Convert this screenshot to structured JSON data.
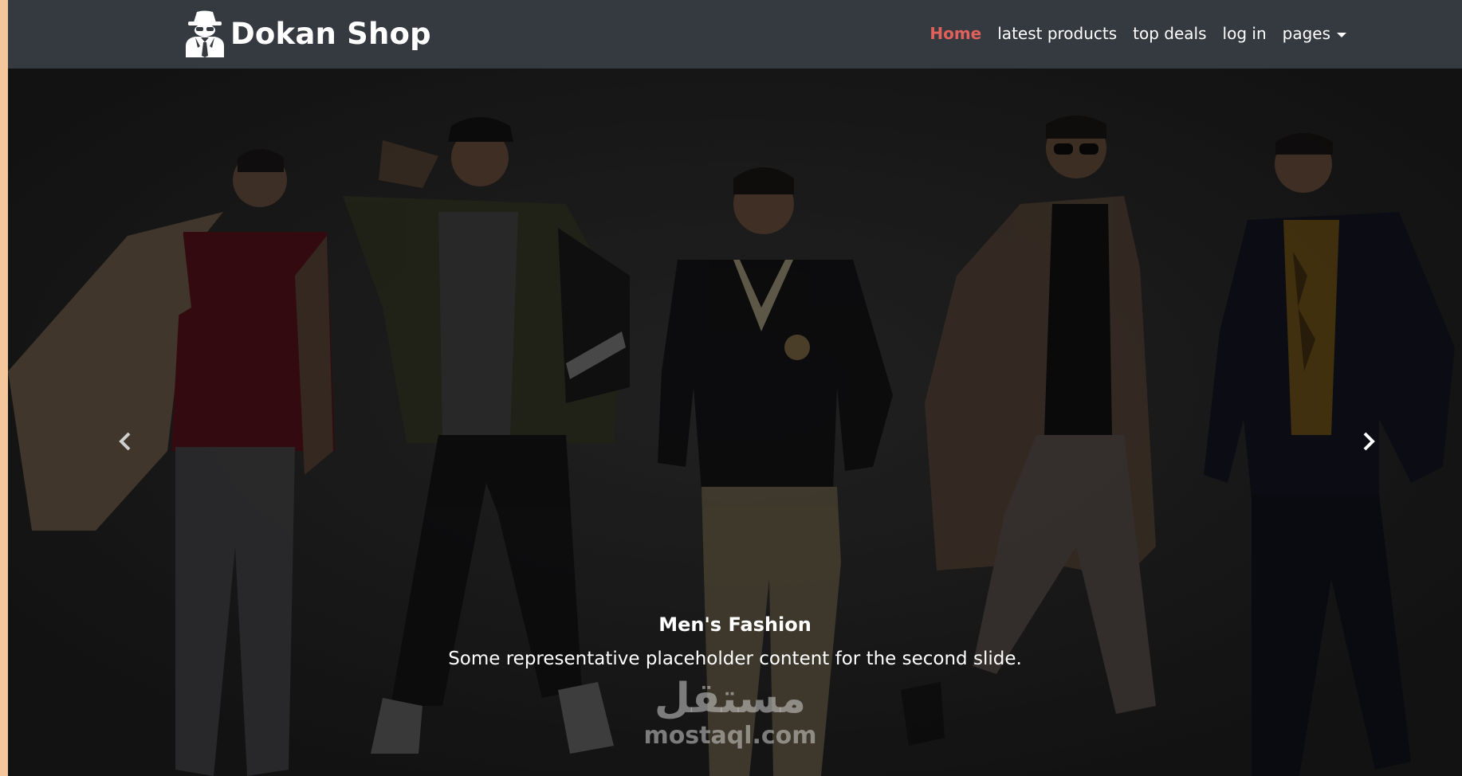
{
  "brand": {
    "name": "Dokan Shop",
    "logo_icon": "user-secret-icon"
  },
  "nav": {
    "items": [
      {
        "label": "Home",
        "active": true
      },
      {
        "label": "latest products",
        "active": false
      },
      {
        "label": "top deals",
        "active": false
      },
      {
        "label": "log in",
        "active": false
      },
      {
        "label": "pages",
        "active": false,
        "dropdown": true
      }
    ]
  },
  "carousel": {
    "caption_title": "Men's Fashion",
    "caption_text": "Some representative placeholder content for the second slide.",
    "prev_icon": "chevron-left-icon",
    "next_icon": "chevron-right-icon"
  },
  "watermark": {
    "arabic": "مستقل",
    "latin": "mostaql.com"
  },
  "colors": {
    "navbar_bg": "#353a40",
    "active_link": "#e0615c",
    "page_edge": "#f4c69b"
  }
}
